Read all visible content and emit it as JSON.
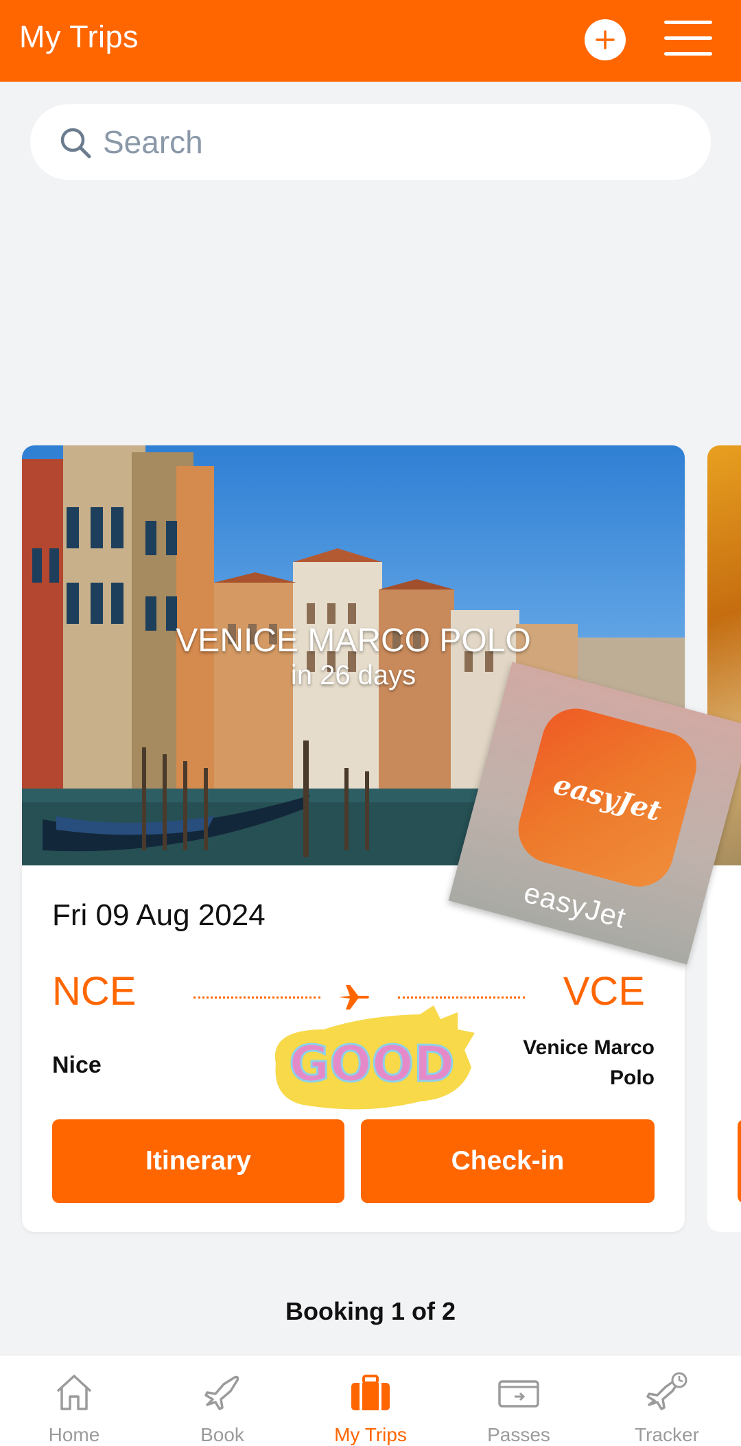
{
  "header": {
    "title": "My Trips"
  },
  "search": {
    "placeholder": "Search"
  },
  "trip_card": {
    "destination": "VENICE MARCO POLO",
    "countdown": "in 26 days",
    "date": "Fri 09 Aug 2024",
    "origin_code": "NCE",
    "destination_code": "VCE",
    "origin_name": "Nice",
    "destination_name": "Venice Marco Polo",
    "itinerary_label": "Itinerary",
    "checkin_label": "Check-in"
  },
  "stickers": {
    "app_icon_text": "easyJet",
    "app_label": "easyJet",
    "good_text": "GOOD"
  },
  "pager": {
    "booking_count": "Booking 1 of 2"
  },
  "bottom_nav": {
    "items": [
      {
        "label": "Home",
        "icon": "home-icon"
      },
      {
        "label": "Book",
        "icon": "plane-icon"
      },
      {
        "label": "My Trips",
        "icon": "suitcase-icon",
        "active": true
      },
      {
        "label": "Passes",
        "icon": "boarding-pass-icon"
      },
      {
        "label": "Tracker",
        "icon": "flight-tracker-icon"
      }
    ]
  },
  "colors": {
    "brand": "#ff6600",
    "background": "#f2f3f5",
    "nav_inactive": "#9b9b9b"
  }
}
